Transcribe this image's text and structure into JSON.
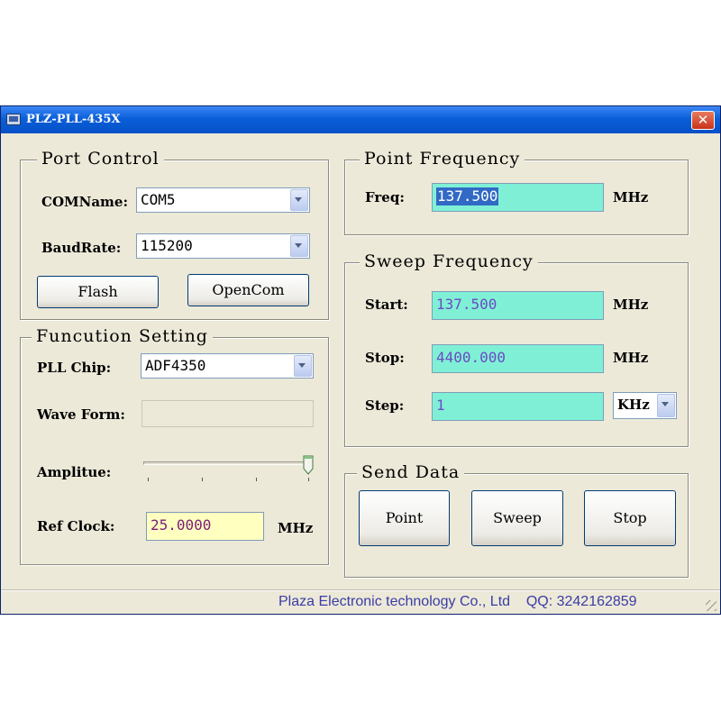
{
  "window": {
    "title": "PLZ-PLL-435X",
    "close_glyph": "✕"
  },
  "port_control": {
    "legend": "Port Control",
    "com_label": "COMName:",
    "com_value": "COM5",
    "baud_label": "BaudRate:",
    "baud_value": "115200",
    "flash_label": "Flash",
    "open_label": "OpenCom"
  },
  "function_setting": {
    "legend": "Funcution Setting",
    "pll_label": "PLL Chip:",
    "pll_value": "ADF4350",
    "wave_label": "Wave Form:",
    "wave_value": "",
    "amp_label": "Amplitue:",
    "amp_level": 1.0,
    "ref_label": "Ref Clock:",
    "ref_value": "25.0000",
    "ref_unit": "MHz"
  },
  "point_frequency": {
    "legend": "Point Frequency",
    "freq_label": "Freq:",
    "freq_value": "137.500",
    "freq_unit": "MHz"
  },
  "sweep_frequency": {
    "legend": "Sweep Frequency",
    "start_label": "Start:",
    "start_value": "137.500",
    "start_unit": "MHz",
    "stop_label": "Stop:",
    "stop_value": "4400.000",
    "stop_unit": "MHz",
    "step_label": "Step:",
    "step_value": "1",
    "step_unit": "KHz"
  },
  "send_data": {
    "legend": "Send Data",
    "point_label": "Point",
    "sweep_label": "Sweep",
    "stop_label": "Stop"
  },
  "status": {
    "text": "Plaza Electronic technology Co., Ltd    QQ: 3242162859"
  },
  "colors": {
    "titlebar": "#0a5fd8",
    "face": "#ece9d8",
    "teal_field": "#7ff0d6",
    "ref_field": "#ffffc0",
    "status_text": "#3c3ca6"
  }
}
